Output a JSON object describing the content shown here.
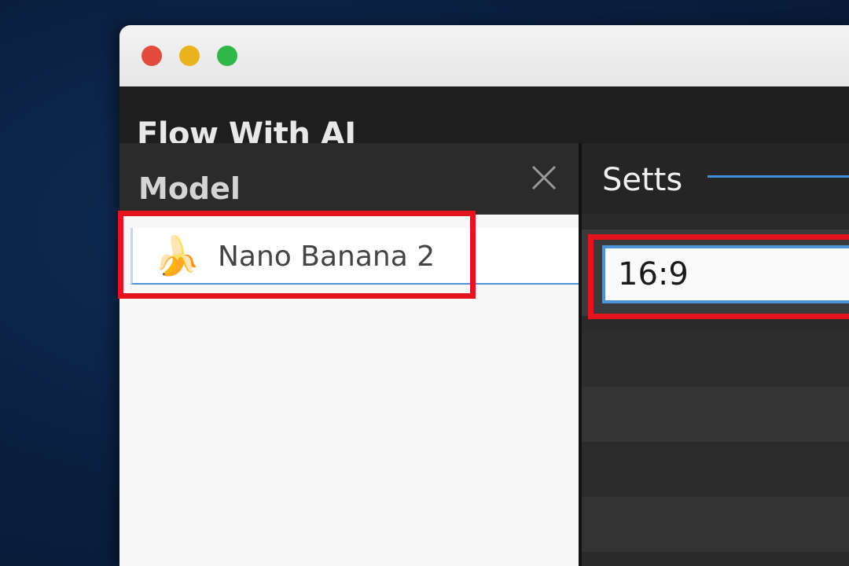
{
  "window": {
    "controls": {
      "close_color": "#e34b3d",
      "minimize_color": "#e9b31d",
      "zoom_color": "#2fb847"
    }
  },
  "app": {
    "title": "Flow With AI"
  },
  "model_panel": {
    "header_label": "Model",
    "close_icon": "close-x-icon",
    "selected_model": {
      "icon": "banana-icon",
      "emoji": "🍌",
      "label": "Nano Banana 2"
    }
  },
  "settings_panel": {
    "header_label": "Setts",
    "aspect_ratio_value": "16:9"
  },
  "highlights": {
    "color": "#e3141b",
    "targets": [
      "model-list-item",
      "aspect-ratio-input"
    ]
  },
  "colors": {
    "accent_blue": "#4c93d8",
    "dark_background": "#1e1e1e",
    "desktop_background": "#0a1f40"
  }
}
